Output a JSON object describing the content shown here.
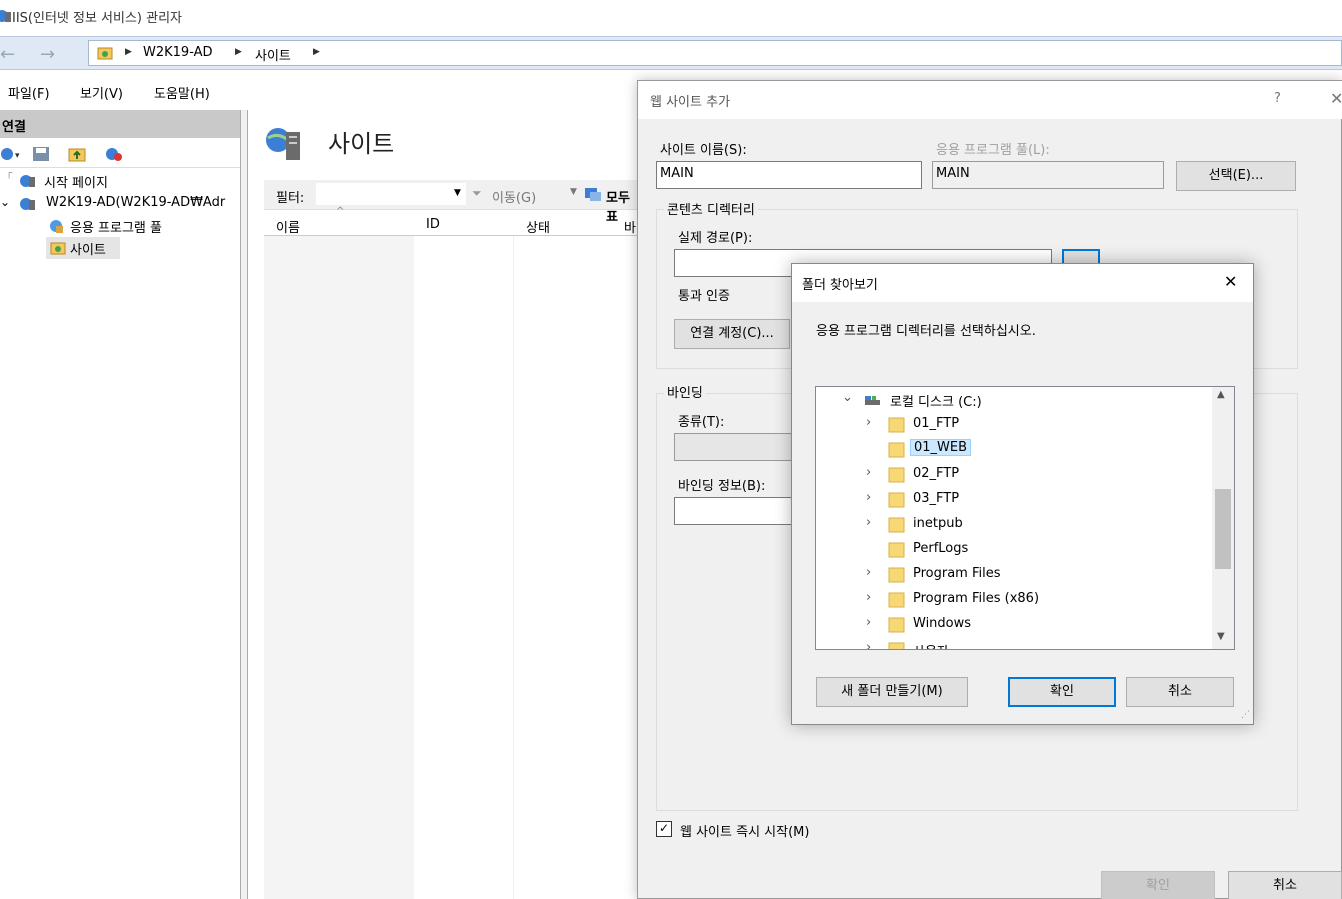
{
  "app": {
    "title": "IIS(인터넷 정보 서비스) 관리자",
    "breadcrumb": [
      "W2K19-AD",
      "사이트"
    ]
  },
  "menu": [
    "파일(F)",
    "보기(V)",
    "도움말(H)"
  ],
  "connections": {
    "header": "연결",
    "tree": [
      {
        "label": "시작 페이지"
      },
      {
        "label": "W2K19-AD(W2K19-AD₩Adr"
      },
      {
        "label": "응용 프로그램 풀"
      },
      {
        "label": "사이트"
      }
    ]
  },
  "center": {
    "title": "사이트",
    "filter_label": "필터:",
    "go_label": "이동(G)",
    "show_all_label": "모두 표",
    "columns": [
      "이름",
      "ID",
      "상태",
      "바"
    ]
  },
  "add_site_dialog": {
    "title": "웹 사이트 추가",
    "help": "?",
    "site_name_label": "사이트 이름(S):",
    "site_name_value": "MAIN",
    "app_pool_label": "응용 프로그램 풀(L):",
    "app_pool_value": "MAIN",
    "select_button": "선택(E)...",
    "content_dir_group": "콘텐츠 디렉터리",
    "physical_path_label": "실제 경로(P):",
    "physical_path_value": "",
    "pass_through_label": "통과 인증",
    "connect_as_button": "연결 계정(C)...",
    "binding_group": "바인딩",
    "type_label": "종류(T):",
    "binding_info_label": "바인딩 정보(B):",
    "start_immediately_label": "웹 사이트 즉시 시작(M)",
    "start_immediately_checked": true,
    "ok_button": "확인",
    "cancel_button": "취소"
  },
  "browse_folder_dialog": {
    "title": "폴더 찾아보기",
    "description": "응용 프로그램 디렉터리를 선택하십시오.",
    "root": "로컬 디스크 (C:)",
    "folders": [
      {
        "name": "01_FTP",
        "expandable": true,
        "selected": false
      },
      {
        "name": "01_WEB",
        "expandable": false,
        "selected": true
      },
      {
        "name": "02_FTP",
        "expandable": true,
        "selected": false
      },
      {
        "name": "03_FTP",
        "expandable": true,
        "selected": false
      },
      {
        "name": "inetpub",
        "expandable": true,
        "selected": false
      },
      {
        "name": "PerfLogs",
        "expandable": false,
        "selected": false
      },
      {
        "name": "Program Files",
        "expandable": true,
        "selected": false
      },
      {
        "name": "Program Files (x86)",
        "expandable": true,
        "selected": false
      },
      {
        "name": "Windows",
        "expandable": true,
        "selected": false
      },
      {
        "name": "사용자",
        "expandable": true,
        "selected": false
      }
    ],
    "new_folder_button": "새 폴더 만들기(M)",
    "ok_button": "확인",
    "cancel_button": "취소"
  },
  "colors": {
    "accent": "#0078d7",
    "folder": "#f8d775",
    "selection": "#cce8ff"
  }
}
